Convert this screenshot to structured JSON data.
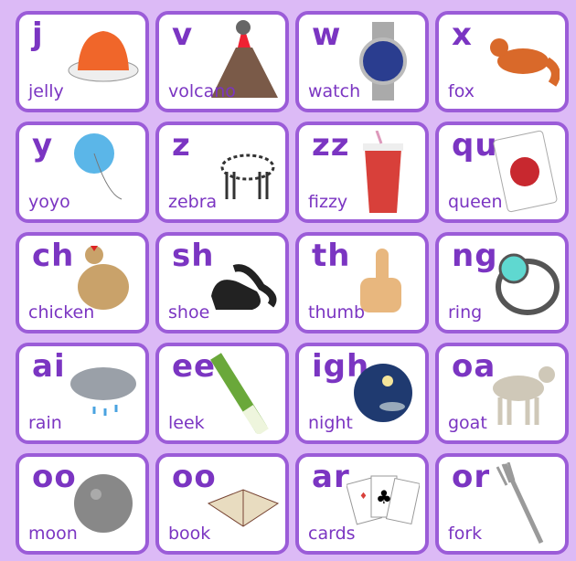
{
  "cards": [
    {
      "sound": "j",
      "word": "jelly",
      "icon": "jelly-icon",
      "color": "#f0662a"
    },
    {
      "sound": "v",
      "word": "volcano",
      "icon": "volcano-icon",
      "color": "#7a5a48"
    },
    {
      "sound": "w",
      "word": "watch",
      "icon": "watch-icon",
      "color": "#2a3d8f"
    },
    {
      "sound": "x",
      "word": "fox",
      "icon": "fox-icon",
      "color": "#d9692a"
    },
    {
      "sound": "y",
      "word": "yoyo",
      "icon": "yoyo-icon",
      "color": "#5bb6e8"
    },
    {
      "sound": "z",
      "word": "zebra",
      "icon": "zebra-icon",
      "color": "#333333"
    },
    {
      "sound": "zz",
      "word": "fizzy",
      "icon": "fizzy-drink-icon",
      "color": "#d8403a"
    },
    {
      "sound": "qu",
      "word": "queen",
      "icon": "queen-card-icon",
      "color": "#c8282f"
    },
    {
      "sound": "ch",
      "word": "chicken",
      "icon": "chicken-icon",
      "color": "#c9a26a"
    },
    {
      "sound": "sh",
      "word": "shoe",
      "icon": "shoe-icon",
      "color": "#222222"
    },
    {
      "sound": "th",
      "word": "thumb",
      "icon": "thumb-icon",
      "color": "#e8b77e"
    },
    {
      "sound": "ng",
      "word": "ring",
      "icon": "ring-icon",
      "color": "#5fd8d0"
    },
    {
      "sound": "ai",
      "word": "rain",
      "icon": "rain-cloud-icon",
      "color": "#9aa0a8"
    },
    {
      "sound": "ee",
      "word": "leek",
      "icon": "leek-icon",
      "color": "#6aa83a"
    },
    {
      "sound": "igh",
      "word": "night",
      "icon": "night-sky-icon",
      "color": "#1f3a70"
    },
    {
      "sound": "oa",
      "word": "goat",
      "icon": "goat-icon",
      "color": "#cfc8b8"
    },
    {
      "sound": "oo",
      "word": "moon",
      "icon": "moon-icon",
      "color": "#888888"
    },
    {
      "sound": "oo",
      "word": "book",
      "icon": "book-icon",
      "color": "#e8dcc0"
    },
    {
      "sound": "ar",
      "word": "cards",
      "icon": "playing-cards-icon",
      "color": "#d8403a"
    },
    {
      "sound": "or",
      "word": "fork",
      "icon": "fork-icon",
      "color": "#9a9a9a"
    }
  ]
}
